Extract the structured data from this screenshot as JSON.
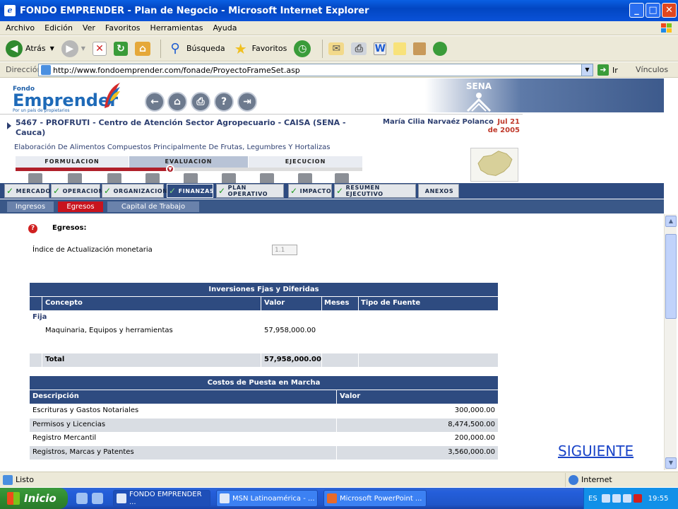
{
  "window": {
    "title": "FONDO EMPRENDER - Plan de Negocio - Microsoft Internet Explorer"
  },
  "menu": [
    "Archivo",
    "Edición",
    "Ver",
    "Favoritos",
    "Herramientas",
    "Ayuda"
  ],
  "toolbar": {
    "back_label": "Atrás",
    "search_label": "Búsqueda",
    "favorites_label": "Favoritos"
  },
  "address": {
    "label": "Dirección",
    "url": "http://www.fondoemprender.com/fonade/ProyectoFrameSet.asp",
    "go_label": "Ir",
    "links_label": "Vínculos"
  },
  "header": {
    "logo_small": "Fondo",
    "logo_big": "Emprender",
    "logo_tagline": "Por un país de propietarios",
    "sena_label": "SENA",
    "project_title": "5467 - PROFRUTI - Centro de Atención Sector Agropecuario - CAISA (SENA - Cauca)",
    "user_name": "María Cilia Narvaéz Polanco",
    "date": "Jul 21 de 2005",
    "subtitle": "Elaboración De Alimentos Compuestos Principalmente De Frutas, Legumbres Y Hortalizas"
  },
  "stages": [
    "FORMULACION",
    "EVALUACION",
    "EJECUCION"
  ],
  "modules": [
    "MERCADO",
    "OPERACION",
    "ORGANIZACION",
    "FINANZAS",
    "PLAN OPERATIVO",
    "IMPACTO",
    "RESUMEN EJECUTIVO",
    "ANEXOS"
  ],
  "subtabs": [
    "Ingresos",
    "Egresos",
    "Capital de Trabajo"
  ],
  "form": {
    "section_label": "Egresos:",
    "index_label": "Índice de Actualización monetaria",
    "index_value": "1.1"
  },
  "table_inversiones": {
    "title": "Inversiones Fjas y Diferidas",
    "headers": [
      "Concepto",
      "Valor",
      "Meses",
      "Tipo de Fuente"
    ],
    "group_label": "Fija",
    "rows": [
      {
        "concepto": "Maquinaria, Equipos y herramientas",
        "valor": "57,958,000.00"
      }
    ],
    "total_label": "Total",
    "total_value": "57,958,000.00"
  },
  "table_costos": {
    "title": "Costos de Puesta en Marcha",
    "headers": [
      "Descripción",
      "Valor"
    ],
    "rows": [
      {
        "descripcion": "Escrituras y Gastos Notariales",
        "valor": "300,000.00"
      },
      {
        "descripcion": "Permisos y Licencias",
        "valor": "8,474,500.00"
      },
      {
        "descripcion": "Registro Mercantil",
        "valor": "200,000.00"
      },
      {
        "descripcion": "Registros, Marcas y Patentes",
        "valor": "3,560,000.00"
      }
    ]
  },
  "siguiente_label": "SIGUIENTE",
  "status": {
    "text": "Listo",
    "zone": "Internet"
  },
  "taskbar": {
    "start_label": "Inicio",
    "tasks": [
      "FONDO EMPRENDER ...",
      "MSN Latinoamérica - ...",
      "Microsoft PowerPoint ..."
    ],
    "lang": "ES",
    "clock": "19:55"
  }
}
